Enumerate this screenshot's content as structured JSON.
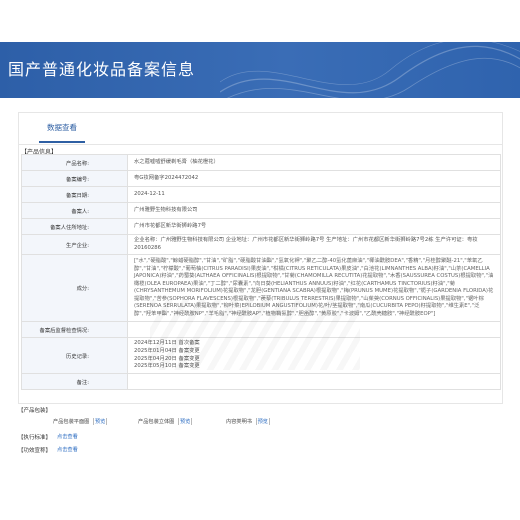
{
  "header": {
    "title": "国产普通化妆品备案信息"
  },
  "tabs": [
    {
      "label": "数据查看"
    }
  ],
  "product_section_title": "【产品信息】",
  "product_rows": [
    {
      "label": "产品名称:",
      "value": "水之蔻嘘嘘舒缓剃毛膏（柚花橙花）"
    },
    {
      "label": "备案编号:",
      "value": "粤G妆网备字2024472042"
    },
    {
      "label": "备案日期:",
      "value": "2024-12-11"
    },
    {
      "label": "备案人:",
      "value": "广州雅野生物科技有限公司"
    },
    {
      "label": "备案人住所地址:",
      "value": "广州市花都区新华街狮岭路7号"
    },
    {
      "label": "生产企业:",
      "value": "企业名称：广州雅野生物科技有限公司 企业地址：广州市花都区新华街狮岭路7号 生产地址：广州市花都区新华街狮岭路7号2栋 生产许可证：粤妆20160286"
    },
    {
      "label": "成分:",
      "value": "[\"水\",\"硬脂酸\",\"鲸蜡硬脂醇\",\"甘油\",\"矿脂\",\"硬脂酸甘油酯\",\"氢氧化钾\",\"聚乙二醇-40氢化蓖麻油\",\"椰油酰胺DEA\",\"香精\",\"月桂醇聚醚-21\",\"苯氧乙醇\",\"甘油\",\"柠檬酸\",\"葡萄柚(CITRUS PARADISI)果皮油\",\"柑橘(CITRUS RETICULATA)果皮油\",\"白池花(LIMNANTHES ALBA)籽油\",\"山茶(CAMELLIA JAPONICA)籽油\",\"药蜀葵(ALTHAEA OFFICINALIS)根提取物\",\"甘菊(CHAMOMILLA RECUTITA)花提取物\",\"木香(SAUSSUREA COSTUS)根提取物\",\"油橄榄(OLEA EUROPAEA)果油\",\"丁二醇\",\"尿囊素\",\"向日葵(HELIANTHUS ANNUUS)籽油\",\"红花(CARTHAMUS TINCTORIUS)籽油\",\"菊(CHRYSANTHEMUM MORIFOLIUM)花提取物\",\"龙胆(GENTIANA SCABRA)根提取物\",\"梅(PRUNUS MUME)花提取物\",\"栀子(GARDENIA FLORIDA)花提取物\",\"苦参(SOPHORA FLAVESCENS)根提取物\",\"蒺藜(TRIBULUS TERRESTRIS)果提取物\",\"山茱萸(CORNUS OFFICINALIS)果提取物\",\"锯叶棕(SERENOA SERRULATA)果提取物\",\"柳叶菜(EPILOBIUM ANGUSTIFOLIUM)花/叶/茎提取物\",\"南瓜(CUCURBITA PEPO)籽提取物\",\"维生素E\",\"泛醇\",\"羟苯甲酯\",\"神经酰胺NP\",\"羊毛脂\",\"神经酰胺AP\",\"植物鞘氨醇\",\"胆甾醇\",\"黄原胶\",\"卡波姆\",\"乙酰壳糖胺\",\"神经酰胺EOP\"]"
    },
    {
      "label": "备案后监督检查情况:",
      "value": ""
    },
    {
      "label": "历史记录:",
      "history": [
        "2024年12月11日 首次备案",
        "2025年01月04日 备案变更",
        "2025年04月20日 备案变更",
        "2025年05月10日 备案变更"
      ]
    },
    {
      "label": "备注:",
      "value": ""
    }
  ],
  "packaging": {
    "title": "【产品包装】",
    "items": [
      {
        "label": "产品包装平面图",
        "button": "预览"
      },
      {
        "label": "产品包装立体图",
        "button": "预览"
      },
      {
        "label": "内容类明书",
        "button": "预览"
      }
    ]
  },
  "standards": {
    "title": "【执行标准】",
    "link": "点击查看"
  },
  "efficacy": {
    "title": "【功效宣称】",
    "link": "点击查看"
  }
}
